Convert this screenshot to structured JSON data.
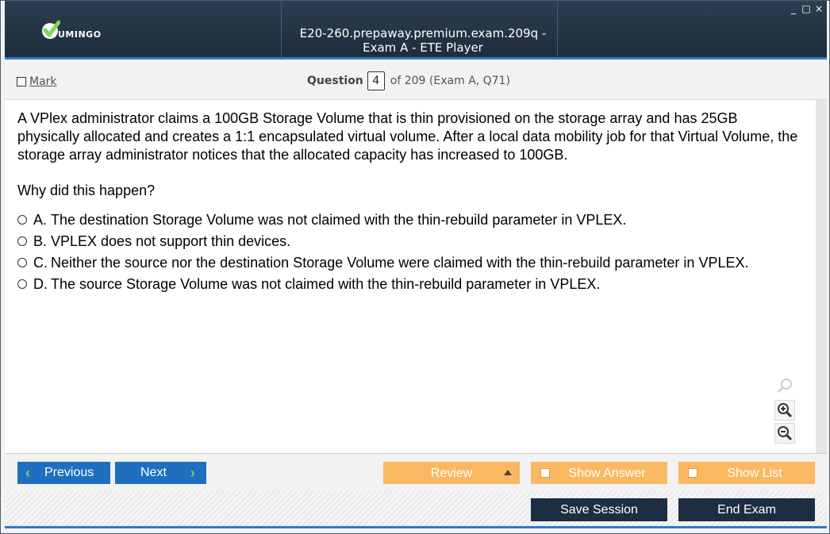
{
  "app": {
    "logo_text": "UMINGO",
    "window_title": "E20-260.prepaway.premium.exam.209q - Exam A - ETE Player",
    "controls": {
      "minimize": "_",
      "maximize": "□",
      "close": "×"
    }
  },
  "header": {
    "mark_label": "Mark",
    "question_label": "Question",
    "question_number": "4",
    "of_text": "of 209 (Exam A, Q71)"
  },
  "question": {
    "text": "A VPlex administrator claims a 100GB Storage Volume that is thin provisioned on the storage array and has 25GB physically allocated and creates a 1:1 encapsulated virtual volume. After a local data mobility job for that Virtual Volume, the storage array administrator notices that the allocated capacity has increased to 100GB.",
    "prompt": "Why did this happen?",
    "answers": [
      {
        "letter": "A.",
        "text": "The destination Storage Volume was not claimed with the thin-rebuild parameter in VPLEX."
      },
      {
        "letter": "B.",
        "text": "VPLEX does not support thin devices."
      },
      {
        "letter": "C.",
        "text": "Neither the source nor the destination Storage Volume were claimed with the thin-rebuild parameter in VPLEX."
      },
      {
        "letter": "D.",
        "text": "The source Storage Volume was not claimed with the thin-rebuild parameter in VPLEX."
      }
    ]
  },
  "buttons": {
    "previous": "Previous",
    "next": "Next",
    "review": "Review",
    "show_answer": "Show Answer",
    "show_list": "Show List",
    "save_session": "Save Session",
    "end_exam": "End Exam"
  },
  "colors": {
    "title_bar": "#1e2d3d",
    "accent_blue": "#2f79c8",
    "nav_button": "#1e6fc0",
    "orange_button": "#fbb862",
    "dark_button": "#1d2e42",
    "check_green": "#7ed957"
  },
  "icons": [
    "check-logo-icon",
    "search-icon",
    "zoom-in-icon",
    "zoom-out-icon",
    "chevron-left-icon",
    "chevron-right-icon",
    "triangle-up-icon"
  ]
}
